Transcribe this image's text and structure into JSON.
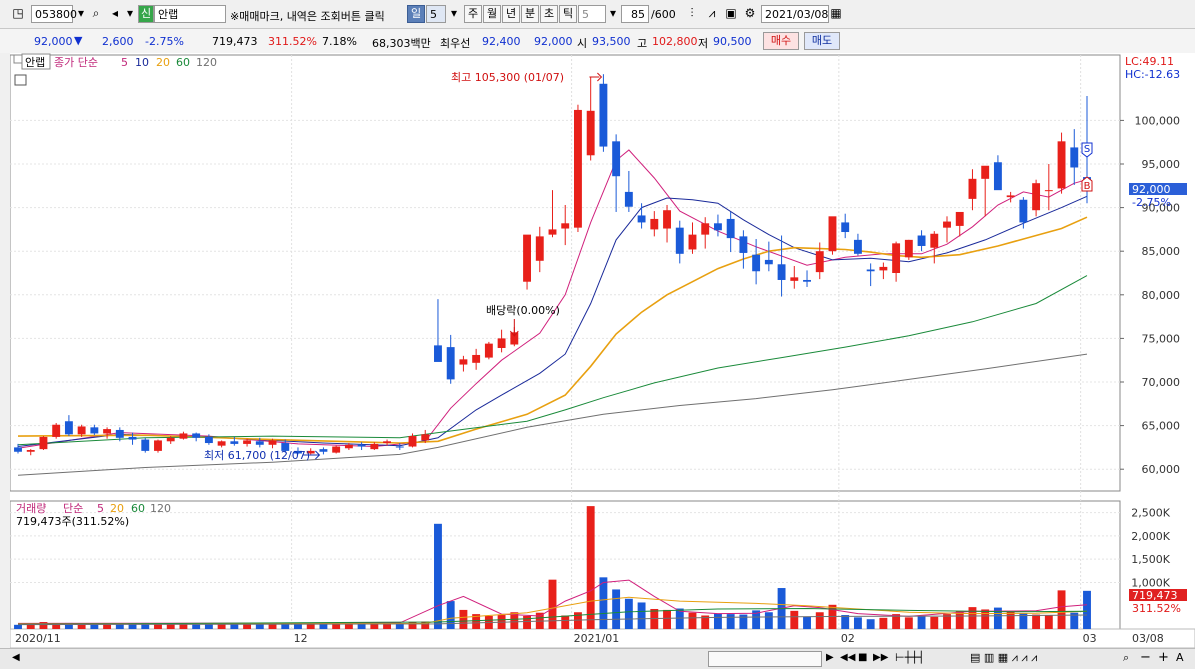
{
  "toolbar": {
    "code": "053800",
    "badge": "신",
    "name": "안랩",
    "notice": "※매매마크, 내역은 조회버튼 클릭",
    "periods": [
      "일",
      "5",
      "주",
      "월",
      "년",
      "분",
      "초",
      "틱"
    ],
    "active_period": "일",
    "interval": "5",
    "count": "85",
    "count_max": "/600",
    "date": "2021/03/08"
  },
  "quote": {
    "price": "92,000",
    "arrow": "▼",
    "change": "2,600",
    "change_pct": "-2.75%",
    "volume": "719,473",
    "volume_pct": "311.52%",
    "turnover": "7.18%",
    "amount": "68,303백만",
    "best_ask_label": "최우선",
    "best_ask": "92,400",
    "best_bid": "92,000",
    "open_label": "시",
    "open": "93,500",
    "high_label": "고",
    "high": "102,800",
    "low_label": "저",
    "low": "90,500",
    "buy_label": "매수",
    "sell_label": "매도"
  },
  "price_panel": {
    "name_tag": "안랩",
    "ma_label": "종가 단순",
    "ma_periods": [
      "5",
      "10",
      "20",
      "60",
      "120"
    ],
    "lc": "LC:49.11",
    "hc": "HC:-12.63",
    "high_note": "최고 105,300 (01/07)",
    "low_note": "최저 61,700 (12/07)",
    "dividend_note": "배당락(0.00%)",
    "last_price_tag": "92,000",
    "last_pct_tag": "-2.75%",
    "sell_marker": "S",
    "buy_marker": "B"
  },
  "volume_panel": {
    "title": "거래량",
    "ma_label": "단순",
    "ma_periods": [
      "5",
      "20",
      "60",
      "120"
    ],
    "last_note": "719,473주(311.52%)",
    "last_tag": "719,473",
    "last_pct_tag": "311.52%"
  },
  "x_axis": [
    "2020/11",
    "12",
    "2021/01",
    "02",
    "03",
    "03/08"
  ],
  "colors": {
    "up": "#e8201a",
    "down": "#1a5ad8",
    "ma5": "#d0207c",
    "ma10": "#1a2a9a",
    "ma20": "#e8a010",
    "ma60": "#1a8a3a",
    "ma120": "#707070"
  },
  "chart_data": {
    "type": "candlestick",
    "price_axis": {
      "ticks": [
        60000,
        65000,
        70000,
        75000,
        80000,
        85000,
        90000,
        95000,
        100000
      ],
      "range": [
        57500,
        107500
      ]
    },
    "volume_axis": {
      "ticks": [
        "1,000K",
        "1,500K",
        "2,000K",
        "2,500K"
      ],
      "tick_values": [
        1000,
        1500,
        2000,
        2500
      ],
      "unit": "K",
      "range": [
        0,
        2750
      ]
    },
    "candles": [
      [
        62500,
        62900,
        61800,
        62000
      ],
      [
        62000,
        62300,
        61600,
        62200
      ],
      [
        62300,
        63800,
        62200,
        63700
      ],
      [
        63700,
        65300,
        63500,
        65100
      ],
      [
        65500,
        66200,
        63800,
        64000
      ],
      [
        64000,
        65100,
        63700,
        64900
      ],
      [
        64800,
        65100,
        63900,
        64100
      ],
      [
        64100,
        64800,
        63500,
        64600
      ],
      [
        64500,
        64800,
        63200,
        63600
      ],
      [
        63700,
        64200,
        62800,
        63400
      ],
      [
        63400,
        63600,
        61900,
        62100
      ],
      [
        62100,
        63400,
        61900,
        63300
      ],
      [
        63200,
        63800,
        62900,
        63600
      ],
      [
        63500,
        64300,
        63400,
        64100
      ],
      [
        64100,
        64200,
        63200,
        63600
      ],
      [
        63700,
        64000,
        62800,
        63000
      ],
      [
        62700,
        63300,
        62500,
        63200
      ],
      [
        63200,
        63700,
        62700,
        62900
      ],
      [
        62900,
        63500,
        62600,
        63300
      ],
      [
        63200,
        63600,
        62500,
        62800
      ],
      [
        62800,
        63500,
        62400,
        63300
      ],
      [
        63000,
        63400,
        61900,
        62100
      ],
      [
        62100,
        62500,
        61700,
        61800
      ],
      [
        61800,
        62400,
        61700,
        62100
      ],
      [
        62300,
        62500,
        61700,
        62000
      ],
      [
        61900,
        62700,
        61800,
        62600
      ],
      [
        62400,
        63000,
        62200,
        62800
      ],
      [
        62800,
        63100,
        62200,
        62600
      ],
      [
        62300,
        63100,
        62200,
        62900
      ],
      [
        63000,
        63400,
        62700,
        63200
      ],
      [
        62600,
        63000,
        62200,
        62500
      ],
      [
        62600,
        64100,
        62500,
        63800
      ],
      [
        63300,
        64500,
        63000,
        64000
      ],
      [
        74200,
        79500,
        72800,
        72300
      ],
      [
        74000,
        75400,
        69800,
        70300
      ],
      [
        72000,
        73000,
        71200,
        72600
      ],
      [
        72200,
        73800,
        71400,
        73100
      ],
      [
        72800,
        74600,
        72600,
        74400
      ],
      [
        73900,
        76000,
        73400,
        75000
      ],
      [
        74300,
        76300,
        74100,
        75700
      ],
      [
        81500,
        83600,
        80600,
        86900
      ],
      [
        83900,
        87800,
        82600,
        86700
      ],
      [
        86900,
        92000,
        86600,
        87500
      ],
      [
        87600,
        90300,
        85700,
        88200
      ],
      [
        87700,
        101800,
        87200,
        101200
      ],
      [
        96000,
        105000,
        95400,
        101100
      ],
      [
        104200,
        105300,
        96400,
        97000
      ],
      [
        97600,
        98400,
        89500,
        93600
      ],
      [
        91800,
        94200,
        89500,
        90100
      ],
      [
        89100,
        90500,
        87600,
        88300
      ],
      [
        87500,
        89600,
        86700,
        88700
      ],
      [
        87600,
        90300,
        86000,
        89700
      ],
      [
        87700,
        88500,
        83600,
        84700
      ],
      [
        85200,
        88300,
        84700,
        86900
      ],
      [
        86900,
        88900,
        85300,
        88200
      ],
      [
        88200,
        89200,
        86700,
        87400
      ],
      [
        88700,
        89500,
        84900,
        86500
      ],
      [
        86700,
        87400,
        83000,
        84800
      ],
      [
        84600,
        86400,
        81200,
        82700
      ],
      [
        84000,
        86100,
        82700,
        83500
      ],
      [
        83500,
        86800,
        79800,
        81700
      ],
      [
        81600,
        83300,
        80700,
        82000
      ],
      [
        81700,
        82800,
        80900,
        81500
      ],
      [
        82600,
        86000,
        81800,
        85000
      ],
      [
        85000,
        88400,
        84600,
        89000
      ],
      [
        88300,
        89300,
        86500,
        87200
      ],
      [
        86300,
        87000,
        84500,
        84700
      ],
      [
        82900,
        83600,
        81000,
        82700
      ],
      [
        82800,
        83700,
        81800,
        83200
      ],
      [
        82500,
        86100,
        81500,
        85900
      ],
      [
        84300,
        86300,
        84000,
        86300
      ],
      [
        86800,
        87400,
        85000,
        85600
      ],
      [
        85400,
        87300,
        83600,
        87000
      ],
      [
        87700,
        89000,
        86000,
        88400
      ],
      [
        87900,
        89400,
        86700,
        89500
      ],
      [
        91000,
        94400,
        89700,
        93300
      ],
      [
        93300,
        94700,
        89000,
        94800
      ],
      [
        95200,
        96000,
        92100,
        92000
      ],
      [
        91200,
        91800,
        90600,
        91400
      ],
      [
        90900,
        91200,
        87600,
        88300
      ],
      [
        89700,
        93200,
        89000,
        92800
      ],
      [
        91900,
        95000,
        89700,
        92000
      ],
      [
        92200,
        98600,
        91600,
        97600
      ],
      [
        96900,
        99000,
        92600,
        94600
      ],
      [
        93500,
        102800,
        90500,
        92000
      ]
    ],
    "volume": [
      90,
      110,
      150,
      120,
      130,
      110,
      100,
      105,
      120,
      115,
      130,
      105,
      100,
      110,
      95,
      105,
      110,
      100,
      115,
      110,
      120,
      110,
      130,
      105,
      100,
      115,
      110,
      120,
      115,
      135,
      130,
      150,
      160,
      2260,
      600,
      410,
      320,
      280,
      300,
      360,
      280,
      350,
      1060,
      290,
      360,
      2640,
      1110,
      850,
      650,
      570,
      430,
      410,
      440,
      350,
      290,
      330,
      320,
      310,
      400,
      360,
      880,
      390,
      260,
      360,
      520,
      300,
      250,
      210,
      240,
      320,
      250,
      270,
      260,
      320,
      390,
      470,
      420,
      460,
      370,
      340,
      310,
      300,
      830,
      350,
      820
    ],
    "ma_lines": {
      "5": [
        [
          0,
          62400
        ],
        [
          8,
          64200
        ],
        [
          15,
          63800
        ],
        [
          22,
          62900
        ],
        [
          28,
          62600
        ],
        [
          32,
          63200
        ],
        [
          34,
          67000
        ],
        [
          36,
          69800
        ],
        [
          38,
          72500
        ],
        [
          41,
          75600
        ],
        [
          43,
          80000
        ],
        [
          45,
          88300
        ],
        [
          47,
          95400
        ],
        [
          48,
          96600
        ],
        [
          50,
          93400
        ],
        [
          52,
          89600
        ],
        [
          55,
          87300
        ],
        [
          58,
          85500
        ],
        [
          62,
          83400
        ],
        [
          65,
          84300
        ],
        [
          68,
          84700
        ],
        [
          71,
          84700
        ],
        [
          73,
          85800
        ],
        [
          75,
          87800
        ],
        [
          77,
          90300
        ],
        [
          79,
          91800
        ],
        [
          81,
          91200
        ],
        [
          83,
          92800
        ],
        [
          84,
          93200
        ]
      ],
      "10": [
        [
          0,
          62600
        ],
        [
          8,
          64000
        ],
        [
          16,
          63600
        ],
        [
          24,
          63000
        ],
        [
          30,
          62700
        ],
        [
          33,
          63600
        ],
        [
          36,
          66800
        ],
        [
          38,
          68500
        ],
        [
          41,
          71000
        ],
        [
          43,
          73200
        ],
        [
          45,
          79000
        ],
        [
          47,
          86300
        ],
        [
          49,
          90000
        ],
        [
          51,
          91100
        ],
        [
          53,
          90900
        ],
        [
          55,
          90500
        ],
        [
          57,
          88600
        ],
        [
          59,
          86900
        ],
        [
          61,
          85400
        ],
        [
          64,
          84000
        ],
        [
          67,
          84200
        ],
        [
          70,
          83800
        ],
        [
          73,
          84800
        ],
        [
          76,
          86300
        ],
        [
          79,
          88200
        ],
        [
          82,
          90000
        ],
        [
          84,
          91300
        ]
      ],
      "20": [
        [
          0,
          63800
        ],
        [
          10,
          63900
        ],
        [
          20,
          63400
        ],
        [
          30,
          63000
        ],
        [
          33,
          63200
        ],
        [
          36,
          64600
        ],
        [
          40,
          66300
        ],
        [
          43,
          68500
        ],
        [
          45,
          71800
        ],
        [
          47,
          75500
        ],
        [
          49,
          78000
        ],
        [
          51,
          80000
        ],
        [
          53,
          81500
        ],
        [
          55,
          83000
        ],
        [
          57,
          84100
        ],
        [
          59,
          85000
        ],
        [
          61,
          85400
        ],
        [
          63,
          85300
        ],
        [
          65,
          85200
        ],
        [
          67,
          84900
        ],
        [
          69,
          84500
        ],
        [
          71,
          84300
        ],
        [
          74,
          84600
        ],
        [
          77,
          85600
        ],
        [
          80,
          86800
        ],
        [
          82,
          87600
        ],
        [
          84,
          88900
        ]
      ],
      "60": [
        [
          0,
          62800
        ],
        [
          10,
          63600
        ],
        [
          20,
          63800
        ],
        [
          30,
          63600
        ],
        [
          33,
          64200
        ],
        [
          40,
          65500
        ],
        [
          43,
          66800
        ],
        [
          46,
          68200
        ],
        [
          50,
          69900
        ],
        [
          55,
          71600
        ],
        [
          60,
          72800
        ],
        [
          65,
          74000
        ],
        [
          70,
          75300
        ],
        [
          75,
          76900
        ],
        [
          80,
          79000
        ],
        [
          84,
          82200
        ]
      ],
      "120": [
        [
          0,
          59300
        ],
        [
          10,
          60200
        ],
        [
          20,
          60800
        ],
        [
          30,
          61700
        ],
        [
          33,
          62500
        ],
        [
          40,
          64800
        ],
        [
          46,
          66300
        ],
        [
          52,
          67300
        ],
        [
          58,
          68100
        ],
        [
          64,
          69100
        ],
        [
          70,
          70300
        ],
        [
          76,
          71500
        ],
        [
          84,
          73200
        ]
      ]
    },
    "volume_ma": {
      "5": [
        [
          0,
          120
        ],
        [
          30,
          130
        ],
        [
          33,
          500
        ],
        [
          35,
          700
        ],
        [
          38,
          320
        ],
        [
          41,
          280
        ],
        [
          43,
          600
        ],
        [
          45,
          820
        ],
        [
          46,
          1000
        ],
        [
          48,
          1050
        ],
        [
          50,
          700
        ],
        [
          52,
          380
        ],
        [
          55,
          330
        ],
        [
          58,
          340
        ],
        [
          61,
          500
        ],
        [
          63,
          460
        ],
        [
          66,
          330
        ],
        [
          70,
          270
        ],
        [
          75,
          380
        ],
        [
          80,
          390
        ],
        [
          82,
          480
        ],
        [
          84,
          520
        ]
      ],
      "20": [
        [
          0,
          110
        ],
        [
          32,
          120
        ],
        [
          34,
          230
        ],
        [
          40,
          350
        ],
        [
          45,
          600
        ],
        [
          48,
          680
        ],
        [
          52,
          600
        ],
        [
          58,
          550
        ],
        [
          62,
          500
        ],
        [
          66,
          430
        ],
        [
          70,
          360
        ],
        [
          75,
          330
        ],
        [
          80,
          340
        ],
        [
          84,
          380
        ]
      ],
      "60": [
        [
          0,
          100
        ],
        [
          33,
          150
        ],
        [
          40,
          220
        ],
        [
          48,
          370
        ],
        [
          55,
          430
        ],
        [
          62,
          440
        ],
        [
          70,
          400
        ],
        [
          78,
          370
        ],
        [
          84,
          380
        ]
      ],
      "120": [
        [
          0,
          95
        ],
        [
          33,
          110
        ],
        [
          45,
          200
        ],
        [
          55,
          250
        ],
        [
          65,
          270
        ],
        [
          75,
          280
        ],
        [
          84,
          300
        ]
      ]
    }
  }
}
